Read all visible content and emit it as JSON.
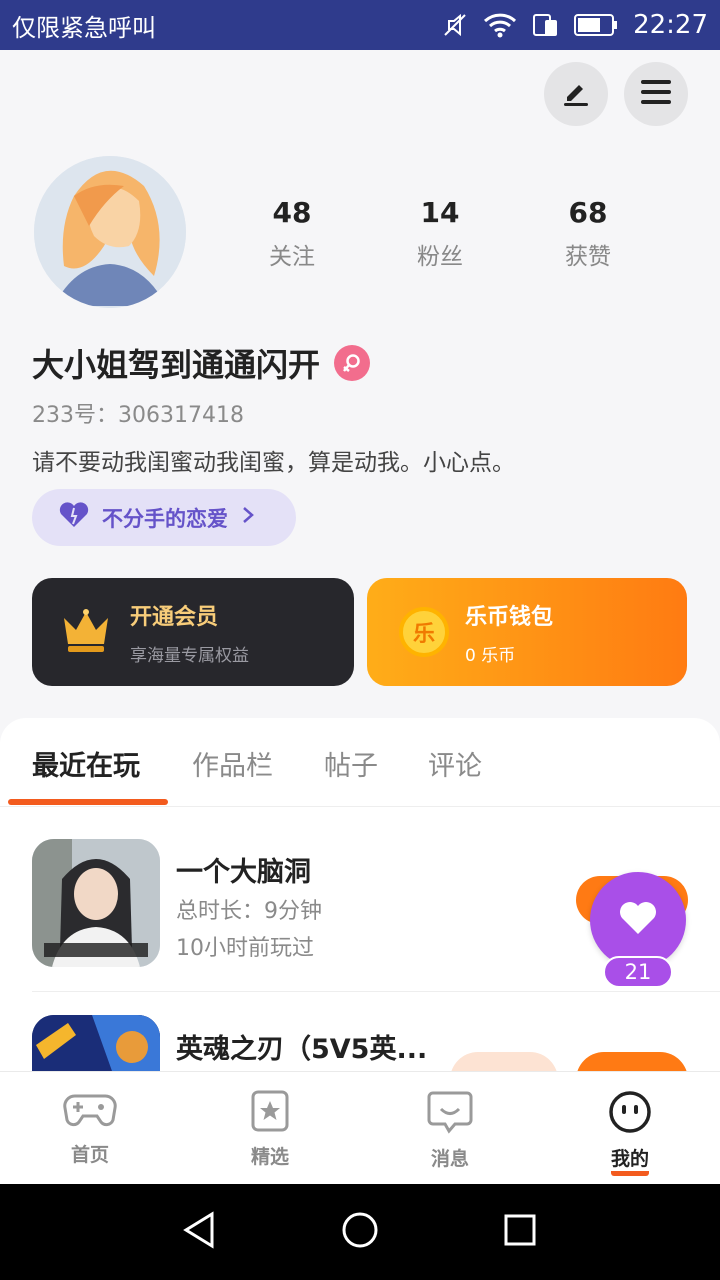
{
  "status_bar": {
    "carrier": "仅限紧急呼叫",
    "time": "22:27"
  },
  "profile": {
    "stats": [
      {
        "num": "48",
        "label": "关注"
      },
      {
        "num": "14",
        "label": "粉丝"
      },
      {
        "num": "68",
        "label": "获赞"
      }
    ],
    "nickname": "大小姐驾到通通闪开",
    "uid": "233号：306317418",
    "bio": "请不要动我闺蜜动我闺蜜，算是动我。小心点。",
    "tag": "不分手的恋爱"
  },
  "cards": {
    "vip_title": "开通会员",
    "vip_sub": "享海量专属权益",
    "wallet_icon": "乐",
    "wallet_title": "乐币钱包",
    "wallet_sub": "0 乐币"
  },
  "tabs": [
    "最近在玩",
    "作品栏",
    "帖子",
    "评论"
  ],
  "games": [
    {
      "title": "一个大脑洞",
      "duration": "总时长：9分钟",
      "last_played": "10小时前玩过"
    },
    {
      "title": "英魂之刃（5V5英..."
    }
  ],
  "float_button": {
    "count": "21"
  },
  "bottom_tabs": [
    "首页",
    "精选",
    "消息",
    "我的"
  ],
  "colors": {
    "accent": "#f35b1e",
    "status_bar": "#2f3b8c",
    "purple": "#a94fe8",
    "orange": "#ff7a14"
  }
}
